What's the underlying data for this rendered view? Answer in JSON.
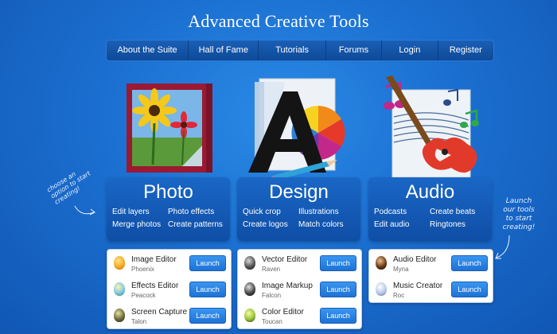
{
  "title": "Advanced Creative Tools",
  "nav": {
    "about": "About the Suite",
    "hall": "Hall of Fame",
    "tutorials": "Tutorials",
    "forums": "Forums",
    "login": "Login",
    "register": "Register"
  },
  "hints": {
    "left": "choose an option to start creating!",
    "right": "Launch our tools to start creating!"
  },
  "columns": [
    {
      "title": "Photo",
      "links": [
        "Edit layers",
        "Photo effects",
        "Merge photos",
        "Create patterns"
      ],
      "tools": [
        {
          "name": "Image Editor",
          "codename": "Phoenix",
          "button": "Launch",
          "icon": "phoenix-egg-icon",
          "color": "#f2a51e"
        },
        {
          "name": "Effects Editor",
          "codename": "Peacock",
          "button": "Launch",
          "icon": "peacock-egg-icon",
          "color": "#7fc7e8"
        },
        {
          "name": "Screen Capture",
          "codename": "Talon",
          "button": "Launch",
          "icon": "talon-egg-icon",
          "color": "#3c3c3c"
        }
      ]
    },
    {
      "title": "Design",
      "links": [
        "Quick crop",
        "Illustrations",
        "Create logos",
        "Match colors"
      ],
      "tools": [
        {
          "name": "Vector Editor",
          "codename": "Raven",
          "button": "Launch",
          "icon": "raven-egg-icon",
          "color": "#444"
        },
        {
          "name": "Image Markup",
          "codename": "Falcon",
          "button": "Launch",
          "icon": "falcon-egg-icon",
          "color": "#333"
        },
        {
          "name": "Color Editor",
          "codename": "Toucan",
          "button": "Launch",
          "icon": "toucan-egg-icon",
          "color": "#9bc33a"
        }
      ]
    },
    {
      "title": "Audio",
      "links": [
        "Podcasts",
        "Create beats",
        "Edit audio",
        "Ringtones"
      ],
      "tools": [
        {
          "name": "Audio Editor",
          "codename": "Myna",
          "button": "Launch",
          "icon": "myna-egg-icon",
          "color": "#6b3a1a"
        },
        {
          "name": "Music Creator",
          "codename": "Roc",
          "button": "Launch",
          "icon": "roc-egg-icon",
          "color": "#b8c9e8"
        }
      ]
    }
  ],
  "colors": {
    "background": "#1b6fd0",
    "panel": "#1a67c6",
    "button": "#2a84e4"
  }
}
